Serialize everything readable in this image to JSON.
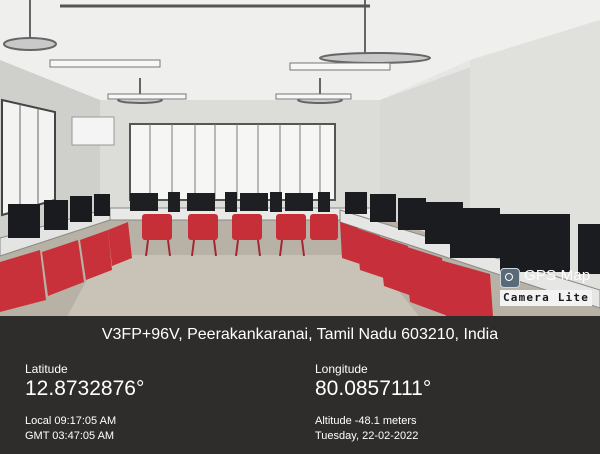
{
  "badge": {
    "title": "GPS Map",
    "subtitle": "Camera Lite",
    "icon": "camera-icon"
  },
  "stamp": {
    "address": "V3FP+96V, Peerakankaranai, Tamil Nadu 603210, India",
    "latitude_label": "Latitude",
    "latitude_value": "12.8732876°",
    "longitude_label": "Longitude",
    "longitude_value": "80.0857111°",
    "local_time": "Local 09:17:05 AM",
    "gmt_time": "GMT 03:47:05 AM",
    "altitude": "Altitude -48.1 meters",
    "date": "Tuesday, 22-02-2022"
  },
  "colors": {
    "chairs": "#c8313a",
    "ceiling": "#ebebea",
    "floor": "#b9b3a8"
  }
}
